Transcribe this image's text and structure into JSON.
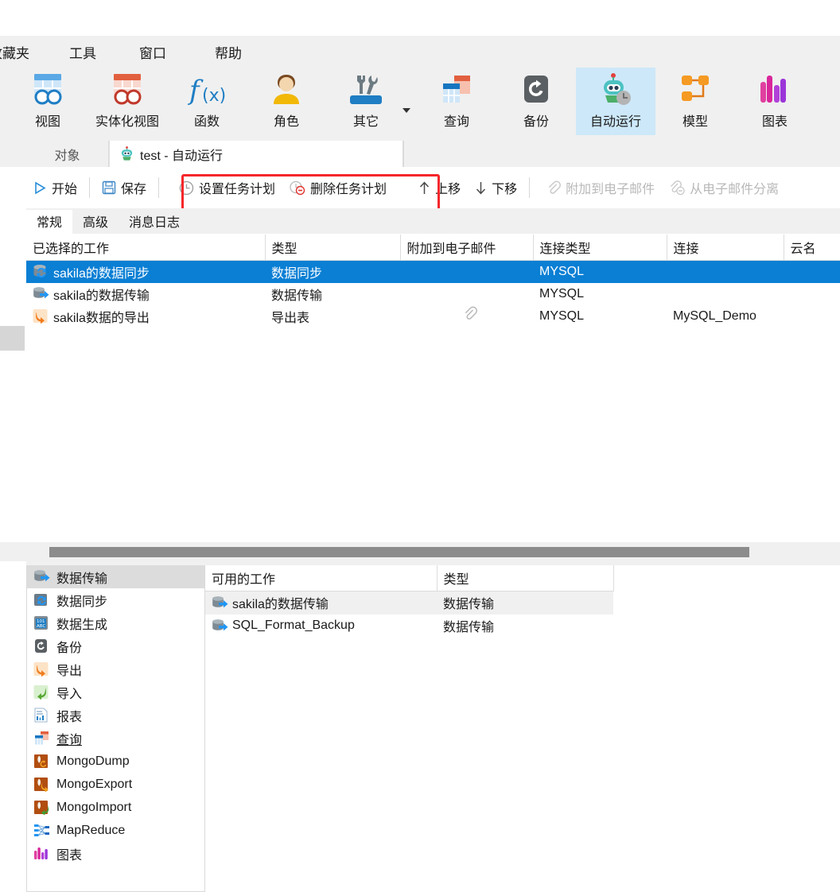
{
  "menubar": {
    "items": [
      {
        "label": "收藏夹",
        "clipped": true
      },
      {
        "label": "工具",
        "clipped": false
      },
      {
        "label": "窗口",
        "clipped": false
      },
      {
        "label": "帮助",
        "clipped": false
      }
    ]
  },
  "ribbon": {
    "buttons": [
      {
        "label": "视图",
        "icon": "view-icon",
        "active": false,
        "caret": false
      },
      {
        "label": "实体化视图",
        "icon": "materialized-view-icon",
        "active": false,
        "caret": false
      },
      {
        "label": "函数",
        "icon": "function-icon",
        "active": false,
        "caret": false
      },
      {
        "label": "角色",
        "icon": "role-user-icon",
        "active": false,
        "caret": false
      },
      {
        "label": "其它",
        "icon": "other-tools-icon",
        "active": false,
        "caret": true
      },
      {
        "label": "查询",
        "icon": "query-icon",
        "active": false,
        "caret": false
      },
      {
        "label": "备份",
        "icon": "backup-icon",
        "active": false,
        "caret": false
      },
      {
        "label": "自动运行",
        "icon": "automation-robot-icon",
        "active": true,
        "caret": false
      },
      {
        "label": "模型",
        "icon": "model-icon",
        "active": false,
        "caret": false
      },
      {
        "label": "图表",
        "icon": "chart-icon",
        "active": false,
        "caret": false
      }
    ]
  },
  "tabstrip": {
    "object_tab": "对象",
    "active_tab": "test - 自动运行",
    "active_tab_icon": "automation-robot-icon"
  },
  "toolbar": {
    "start_label": "开始",
    "save_label": "保存",
    "set_schedule_label": "设置任务计划",
    "delete_schedule_label": "删除任务计划",
    "move_up_label": "上移",
    "move_down_label": "下移",
    "attach_email_label": "附加到电子邮件",
    "detach_email_label": "从电子邮件分离",
    "highlight_color": "#f5262a"
  },
  "inner_tabs": {
    "items": [
      {
        "label": "常规",
        "selected": true
      },
      {
        "label": "高级",
        "selected": false
      },
      {
        "label": "消息日志",
        "selected": false
      }
    ]
  },
  "main_grid": {
    "columns": [
      "已选择的工作",
      "类型",
      "附加到电子邮件",
      "连接类型",
      "连接",
      "云名"
    ],
    "rows": [
      {
        "icon": "data-sync-icon",
        "name": "sakila的数据同步",
        "type": "数据同步",
        "attach": "",
        "conn_type": "MYSQL",
        "connection": "",
        "cloud": "",
        "selected": true
      },
      {
        "icon": "data-transfer-icon",
        "name": "sakila的数据传输",
        "type": "数据传输",
        "attach": "",
        "conn_type": "MYSQL",
        "connection": "",
        "cloud": "",
        "selected": false
      },
      {
        "icon": "export-icon",
        "name": "sakila数据的导出",
        "type": "导出表",
        "attach": "paperclip-icon",
        "conn_type": "MYSQL",
        "connection": "MySQL_Demo",
        "cloud": "",
        "selected": false
      }
    ],
    "selection_color": "#0a7fd4"
  },
  "bottom_left": {
    "items": [
      {
        "label": "数据传输",
        "icon": "data-transfer-icon",
        "selected": true,
        "underline": false
      },
      {
        "label": "数据同步",
        "icon": "data-sync-icon",
        "selected": false,
        "underline": false
      },
      {
        "label": "数据生成",
        "icon": "data-generation-icon",
        "selected": false,
        "underline": false
      },
      {
        "label": "备份",
        "icon": "backup-icon",
        "selected": false,
        "underline": false
      },
      {
        "label": "导出",
        "icon": "export-icon",
        "selected": false,
        "underline": false
      },
      {
        "label": "导入",
        "icon": "import-icon",
        "selected": false,
        "underline": false
      },
      {
        "label": "报表",
        "icon": "report-icon",
        "selected": false,
        "underline": false
      },
      {
        "label": "查询",
        "icon": "query-icon",
        "selected": false,
        "underline": true
      },
      {
        "label": "MongoDump",
        "icon": "mongodump-icon",
        "selected": false,
        "underline": false
      },
      {
        "label": "MongoExport",
        "icon": "mongoexport-icon",
        "selected": false,
        "underline": false
      },
      {
        "label": "MongoImport",
        "icon": "mongoimport-icon",
        "selected": false,
        "underline": false
      },
      {
        "label": "MapReduce",
        "icon": "mapreduce-icon",
        "selected": false,
        "underline": false
      },
      {
        "label": "图表",
        "icon": "chart-icon",
        "selected": false,
        "underline": false
      }
    ]
  },
  "bottom_right": {
    "columns": [
      "可用的工作",
      "类型"
    ],
    "rows": [
      {
        "icon": "data-transfer-icon",
        "name": "sakila的数据传输",
        "type": "数据传输",
        "alt": true
      },
      {
        "icon": "data-transfer-icon",
        "name": "SQL_Format_Backup",
        "type": "数据传输",
        "alt": false
      }
    ]
  },
  "scrollbar": {
    "orientation": "horizontal",
    "thumb_color": "#8c8c8c"
  }
}
